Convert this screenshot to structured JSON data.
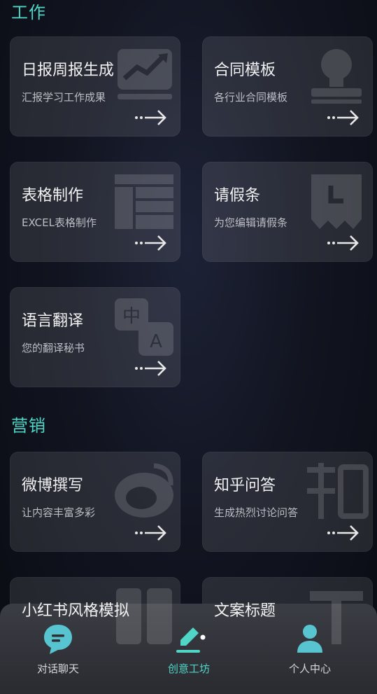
{
  "sections": {
    "work": {
      "title": "工作"
    },
    "marketing": {
      "title": "营销"
    }
  },
  "cards": {
    "daily_report": {
      "title": "日报周报生成",
      "subtitle": "汇报学习工作成果",
      "icon": "trend-chart-icon"
    },
    "contract": {
      "title": "合同模板",
      "subtitle": "各行业合同模板",
      "icon": "stamp-icon"
    },
    "spreadsheet": {
      "title": "表格制作",
      "subtitle": "EXCEL表格制作",
      "icon": "table-icon"
    },
    "leave": {
      "title": "请假条",
      "subtitle": "为您编辑请假条",
      "icon": "clock-note-icon"
    },
    "translate": {
      "title": "语言翻译",
      "subtitle": "您的翻译秘书",
      "icon": "translate-icon"
    },
    "weibo": {
      "title": "微博撰写",
      "subtitle": "让内容丰富多彩",
      "icon": "weibo-icon"
    },
    "zhihu": {
      "title": "知乎问答",
      "subtitle": "生成热烈讨论问答",
      "icon": "zhihu-icon"
    },
    "xiaohongshu": {
      "title": "小红书风格模拟",
      "icon": "book-icon"
    },
    "copy_title": {
      "title": "文案标题",
      "icon": "title-t-icon"
    }
  },
  "nav": {
    "chat": {
      "label": "对话聊天",
      "icon": "chat-bubble-icon"
    },
    "workshop": {
      "label": "创意工坊",
      "icon": "pen-icon"
    },
    "profile": {
      "label": "个人中心",
      "icon": "person-icon"
    }
  },
  "colors": {
    "accent": "#4fd6c6",
    "card_bg": "#2a2b33",
    "nav_bg": "#34363d"
  }
}
